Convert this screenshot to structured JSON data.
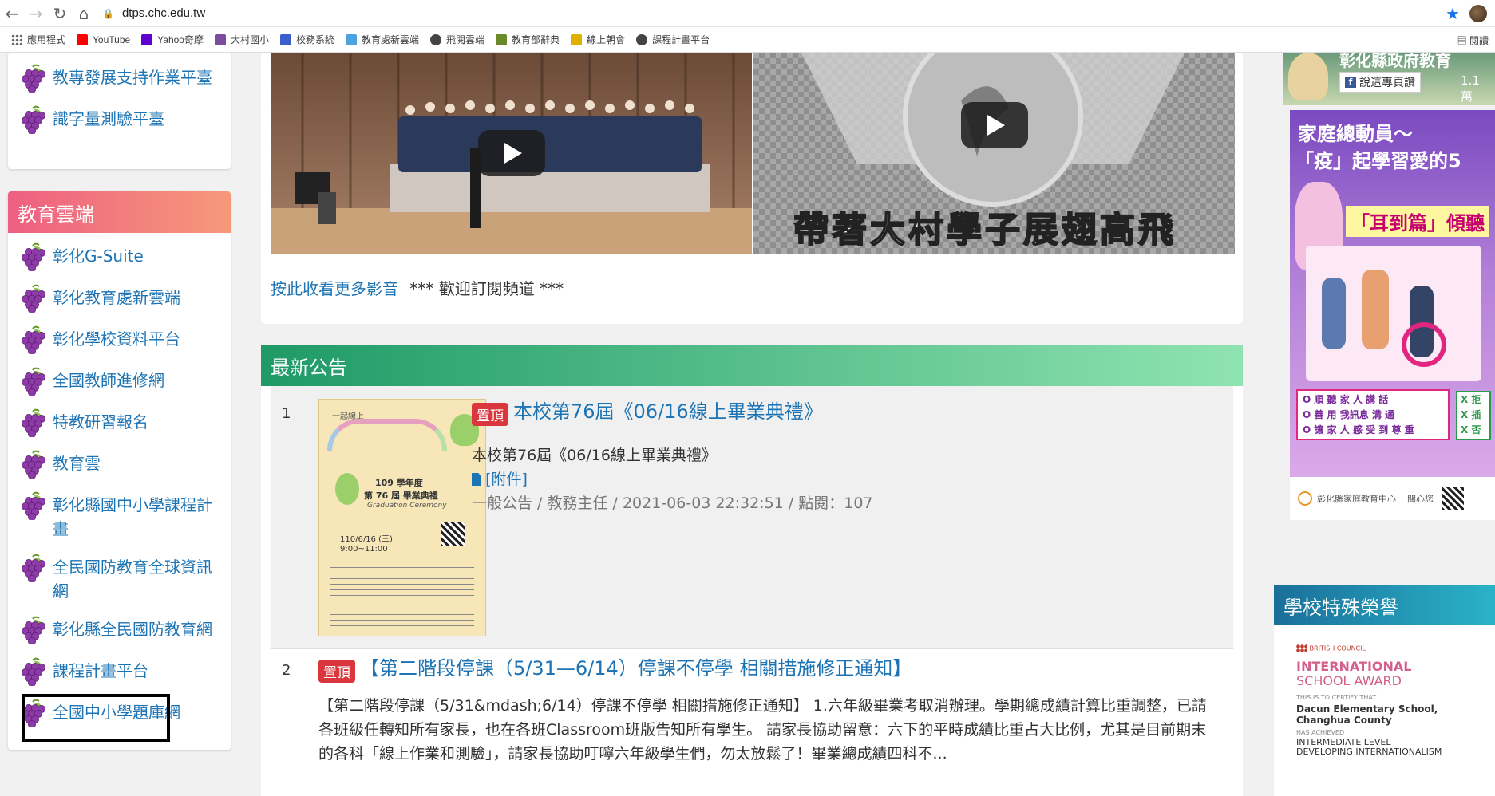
{
  "browser": {
    "url": "dtps.chc.edu.tw",
    "bookmarks": [
      {
        "label": "應用程式",
        "icon": "apps-icon",
        "color": "#5f6368"
      },
      {
        "label": "YouTube",
        "icon": "youtube-icon",
        "color": "#ff0000"
      },
      {
        "label": "Yahoo奇摩",
        "icon": "yahoo-icon",
        "color": "#5f01d1"
      },
      {
        "label": "大村國小",
        "icon": "school-icon",
        "color": "#7b4b9e"
      },
      {
        "label": "校務系統",
        "icon": "system-icon",
        "color": "#3a5fcd"
      },
      {
        "label": "教育處新雲端",
        "icon": "cloud-icon",
        "color": "#4aa3df"
      },
      {
        "label": "飛閱雲端",
        "icon": "globe-icon",
        "color": "#444444"
      },
      {
        "label": "教育部辭典",
        "icon": "dictionary-icon",
        "color": "#6a8a2a"
      },
      {
        "label": "線上朝會",
        "icon": "meeting-icon",
        "color": "#e0b000"
      },
      {
        "label": "課程計畫平台",
        "icon": "globe-icon",
        "color": "#444444"
      }
    ],
    "reading_list": "閱讀"
  },
  "left_sidebar": {
    "top_links": [
      "教專發展支持作業平臺",
      "識字量測驗平臺"
    ],
    "cloud_section": {
      "title": "教育雲端",
      "links": [
        "彰化G-Suite",
        "彰化教育處新雲端",
        "彰化學校資料平台",
        "全國教師進修網",
        "特教研習報名",
        "教育雲",
        "彰化縣國中小學課程計畫",
        "全民國防教育全球資訊網",
        "彰化縣全民國防教育網",
        "課程計畫平台",
        "全國中小學題庫網"
      ]
    }
  },
  "video_section": {
    "video2_caption": "帶著大村學子展翅高飛",
    "more_link": "按此收看更多影音",
    "subscribe_text": "*** 歡迎訂閱頻道 ***"
  },
  "news": {
    "title": "最新公告",
    "items": [
      {
        "index": "1",
        "pin": "置頂",
        "title": "本校第76屆《06/16線上畢業典禮》",
        "summary": "本校第76屆《06/16線上畢業典禮》",
        "attachment": "[附件]",
        "meta": "一般公告 / 教務主任 / 2021-06-03 22:32:51 / 點閱：107",
        "thumb_lines": {
          "top": "一起線上",
          "year": "109 學年度",
          "grad": "第 76 屆 畢業典禮",
          "en": "Graduation Ceremony",
          "date": "110/6/16 (三)",
          "time": "9:00~11:00"
        }
      },
      {
        "index": "2",
        "pin": "置頂",
        "title": "【第二階段停課（5/31—6/14）停課不停學 相關措施修正通知】",
        "summary": "【第二階段停課（5/31&mdash;6/14）停課不停學 相關措施修正通知】 1.六年級畢業考取消辦理。學期總成績計算比重調整，已請各班級任轉知所有家長，也在各班Classroom班版告知所有學生。 請家長協助留意：六下的平時成績比重占大比例，尤其是目前期末的各科「線上作業和測驗」，請家長協助叮嚀六年級學生們，勿太放鬆了！畢業總成績四科不..."
      }
    ]
  },
  "right_sidebar": {
    "fb_title": "彰化縣政府教育",
    "fb_button": "說這專頁讚",
    "fb_count": "1.1 萬",
    "poster": {
      "line1": "家庭總動員～",
      "line2": "「疫」起學習愛的5",
      "ear_label": "「耳到篇」傾聽",
      "bullets": [
        "O 順 聽 家 人 講 話",
        "O 善 用 我訊息 溝 通",
        "O 讓 家 人 感 受 到 尊 重"
      ],
      "x_marks": [
        "X 拒",
        "X 插",
        "X 否"
      ],
      "footer": "彰化縣家庭教育中心",
      "footer2": "關心您"
    },
    "honor": {
      "title": "學校特殊榮譽",
      "org": "BRITISH COUNCIL",
      "award1": "INTERNATIONAL",
      "award2": "SCHOOL AWARD",
      "certify": "THIS IS TO CERTIFY THAT",
      "school": "Dacun Elementary School,",
      "county": "Changhua County",
      "achieved": "HAS ACHIEVED",
      "level1": "INTERMEDIATE LEVEL",
      "level2": "DEVELOPING INTERNATIONALISM"
    }
  },
  "colors": {
    "link": "#1d74b5",
    "cloud_header_start": "#ee5f81",
    "news_header_start": "#1f9a67",
    "pin": "#d9363e",
    "honor_header": "#1a6f9a"
  }
}
